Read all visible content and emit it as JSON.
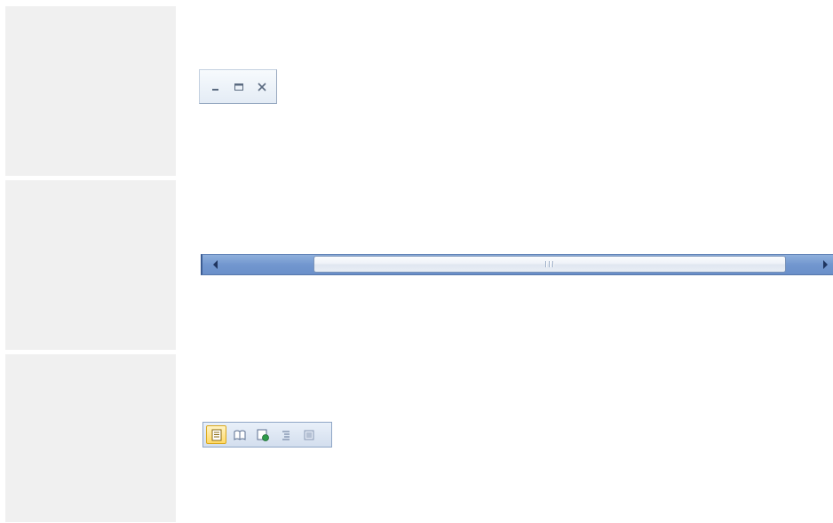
{
  "panels": [
    "panel-1",
    "panel-2",
    "panel-3"
  ],
  "caption_controls": {
    "buttons": [
      "minimize-icon",
      "maximize-icon",
      "close-icon"
    ]
  },
  "horizontal_scrollbar": {
    "left_arrow_icon": "scroll-left-arrow-icon",
    "right_arrow_icon": "scroll-right-arrow-icon",
    "thumb_grip_icon": "grip-icon",
    "scroll_position": 0.19,
    "visible_fraction": 0.75
  },
  "view_switcher": {
    "buttons": [
      {
        "icon": "normal-view-icon",
        "active": true
      },
      {
        "icon": "reading-view-icon",
        "active": false
      },
      {
        "icon": "web-view-icon",
        "active": false
      },
      {
        "icon": "outline-view-icon",
        "active": false
      },
      {
        "icon": "draft-view-icon",
        "active": false
      }
    ]
  },
  "colors": {
    "panel_background": "#f0f0f0",
    "scrollbar_track": "#7297cf",
    "active_view_highlight": "#ffd968"
  }
}
